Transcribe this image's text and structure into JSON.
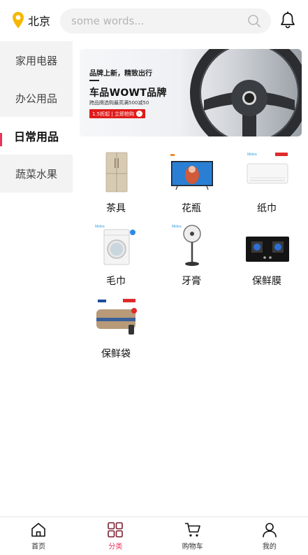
{
  "header": {
    "location": "北京",
    "search_placeholder": "some words..."
  },
  "sidebar": {
    "items": [
      {
        "label": "家用电器"
      },
      {
        "label": "办公用品"
      },
      {
        "label": "日常用品",
        "active": true
      },
      {
        "label": "蔬菜水果"
      }
    ]
  },
  "banner": {
    "line1": "品牌上新，精致出行",
    "line2": "车品WOWT品牌",
    "line3": "跨品牌选购最高满500减50",
    "button": "1.5折起 | 立即抢购"
  },
  "products": [
    {
      "label": "茶具",
      "icon": "fridge-image"
    },
    {
      "label": "花瓶",
      "icon": "tv-image"
    },
    {
      "label": "纸巾",
      "icon": "air-conditioner-image"
    },
    {
      "label": "毛巾",
      "icon": "washing-machine-image"
    },
    {
      "label": "牙膏",
      "icon": "fan-image"
    },
    {
      "label": "保鲜膜",
      "icon": "gas-stove-image"
    },
    {
      "label": "保鲜袋",
      "icon": "water-heater-image"
    }
  ],
  "bottom_nav": [
    {
      "label": "首页",
      "icon": "home-icon"
    },
    {
      "label": "分类",
      "icon": "category-icon",
      "active": true
    },
    {
      "label": "购物车",
      "icon": "cart-icon"
    },
    {
      "label": "我的",
      "icon": "user-icon"
    }
  ],
  "colors": {
    "accent": "#e8335a",
    "location_pin": "#f5b800",
    "sidebar_bg": "#f3f3f3"
  }
}
